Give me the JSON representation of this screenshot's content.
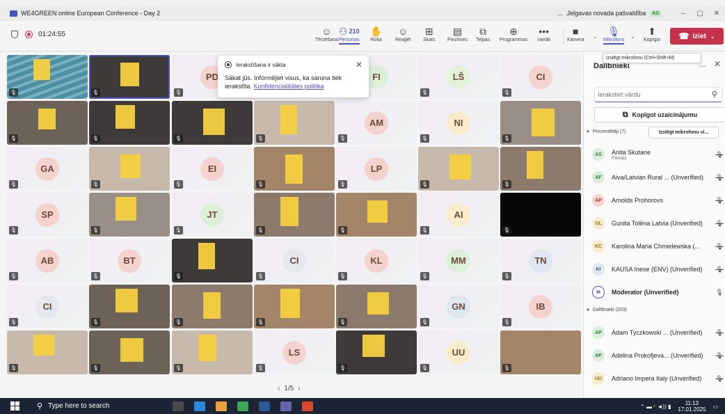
{
  "window": {
    "title": "WE4GREEN online European Conference - Day 2",
    "more": "...",
    "org": "Jelgavas novada pašvaldība",
    "badge": "AS",
    "controls": [
      "–",
      "▢",
      "✕"
    ]
  },
  "toolbar": {
    "timer": "01:24:55",
    "buttons": [
      {
        "label": "Tērzēšana",
        "icon": "chat-icon",
        "glyph": "☺"
      },
      {
        "label": "Personas",
        "icon": "people-icon",
        "glyph": "⚇",
        "count": "210"
      },
      {
        "label": "Roka",
        "icon": "hand-icon",
        "glyph": "✋"
      },
      {
        "label": "Reaģēt",
        "icon": "react-icon",
        "glyph": "☺"
      },
      {
        "label": "Skats",
        "icon": "view-icon",
        "glyph": "⊞"
      },
      {
        "label": "Piezīmes",
        "icon": "notes-icon",
        "glyph": "▤"
      },
      {
        "label": "Telpas",
        "icon": "rooms-icon",
        "glyph": "⧉"
      },
      {
        "label": "Programmas",
        "icon": "apps-icon",
        "glyph": "⊕"
      },
      {
        "label": "Vairāk",
        "icon": "more-icon",
        "glyph": "•••"
      },
      {
        "label": "Kamera",
        "icon": "camera-icon",
        "glyph": "■"
      },
      {
        "label": "Mikrofons",
        "icon": "microphone-icon",
        "glyph": "🎙"
      },
      {
        "label": "Kopīgot",
        "icon": "share-icon",
        "glyph": "⬆"
      }
    ],
    "leave_label": "Iziet",
    "mic_tooltip": "Izslēgt mikrofonu (Ctrl+Shift+M)"
  },
  "toast": {
    "heading": "Ierakstīšana ir sākta",
    "body": "Sākat jūs. Informējiet visus, ka saruna tiek ierakstīta.",
    "link": "Konfidencialitātes politika"
  },
  "grid": {
    "tiles": [
      {
        "kind": "sea",
        "blur": true,
        "selected": false,
        "mic": "muted"
      },
      {
        "kind": "v3",
        "blur": true,
        "selected": true
      },
      {
        "kind": "avatar",
        "initials": "PD",
        "color": "#f4d3cf"
      },
      {
        "kind": "avatar",
        "initials": "",
        "hidden": true
      },
      {
        "kind": "avatar",
        "initials": "FI",
        "color": "#dcefd9"
      },
      {
        "kind": "avatar",
        "initials": "LŠ",
        "color": "#e3f2d9"
      },
      {
        "kind": "avatar",
        "initials": "CI",
        "color": "#f4d3cf"
      },
      {
        "kind": "v1",
        "blur": true
      },
      {
        "kind": "v3",
        "blur": true
      },
      {
        "kind": "v3",
        "blur": true
      },
      {
        "kind": "v5",
        "blur": true
      },
      {
        "kind": "avatar",
        "initials": "AM",
        "color": "#f4d3cf"
      },
      {
        "kind": "avatar",
        "initials": "NI",
        "color": "#f8eccc"
      },
      {
        "kind": "v2",
        "blur": true
      },
      {
        "kind": "avatar",
        "initials": "GA",
        "color": "#f4d3cf"
      },
      {
        "kind": "v5",
        "blur": true
      },
      {
        "kind": "avatar",
        "initials": "EI",
        "color": "#f4d3cf"
      },
      {
        "kind": "v6",
        "blur": true
      },
      {
        "kind": "avatar",
        "initials": "LP",
        "color": "#f4d3cf"
      },
      {
        "kind": "v5",
        "blur": true
      },
      {
        "kind": "v4",
        "blur": true
      },
      {
        "kind": "avatar",
        "initials": "SP",
        "color": "#f4d3cf"
      },
      {
        "kind": "v2",
        "blur": true
      },
      {
        "kind": "avatar",
        "initials": "JT",
        "color": "#dcefd9"
      },
      {
        "kind": "v4",
        "blur": true
      },
      {
        "kind": "v6",
        "blur": true
      },
      {
        "kind": "avatar",
        "initials": "AI",
        "color": "#f8eccc"
      },
      {
        "kind": "black",
        "blur": false
      },
      {
        "kind": "avatar",
        "initials": "AB",
        "color": "#f4d3cf"
      },
      {
        "kind": "avatar",
        "initials": "BT",
        "color": "#f4d3cf"
      },
      {
        "kind": "v3",
        "blur": true
      },
      {
        "kind": "avatar",
        "initials": "CI",
        "color": "#e4e8ee"
      },
      {
        "kind": "avatar",
        "initials": "KL",
        "color": "#f4d3cf"
      },
      {
        "kind": "avatar",
        "initials": "MM",
        "color": "#dcefd9"
      },
      {
        "kind": "avatar",
        "initials": "TN",
        "color": "#dfe7f2"
      },
      {
        "kind": "avatar",
        "initials": "CI",
        "color": "#e4e8ee"
      },
      {
        "kind": "v1",
        "blur": true
      },
      {
        "kind": "v4",
        "blur": true
      },
      {
        "kind": "v6",
        "blur": true
      },
      {
        "kind": "v4",
        "blur": true
      },
      {
        "kind": "avatar",
        "initials": "GN",
        "color": "#dfe7f2"
      },
      {
        "kind": "avatar",
        "initials": "IB",
        "color": "#f4d3cf"
      },
      {
        "kind": "v5",
        "blur": true
      },
      {
        "kind": "v1",
        "blur": true
      },
      {
        "kind": "v5",
        "blur": true
      },
      {
        "kind": "avatar",
        "initials": "LS",
        "color": "#f4d3cf"
      },
      {
        "kind": "v3",
        "blur": true
      },
      {
        "kind": "avatar",
        "initials": "UU",
        "color": "#f8eccc"
      },
      {
        "kind": "v6",
        "blur": false
      }
    ],
    "pager": {
      "prev": "‹",
      "label": "1/5",
      "next": "›"
    }
  },
  "panel": {
    "title": "Dalībnieki",
    "more": "...",
    "close": "✕",
    "search_placeholder": "Ierakstiet vārdu",
    "copy_label": "Kopīgot uzaicinājumu",
    "presenters_header": "Prezentētāji (7)",
    "mute_all": "Izslēgt mikrofonu vi...",
    "presenters": [
      {
        "initials": "AS",
        "name": "Anita Skutane",
        "sub": "Rīkotājs",
        "color": "#d9ecdd",
        "text": "#2e7d32",
        "muted": true
      },
      {
        "initials": "AF",
        "name": "Aiva/Latvian Rural ... (Unverified)",
        "color": "#d9ecdd",
        "text": "#2e7d32",
        "muted": true
      },
      {
        "initials": "AP",
        "name": "Arnolds Prohorovs",
        "color": "#f6d5d2",
        "text": "#b23a2e",
        "muted": true
      },
      {
        "initials": "GL",
        "name": "Gunita Tolēna Latvia (Unverified)",
        "color": "#f7ebcc",
        "text": "#8a6d1a",
        "muted": true
      },
      {
        "initials": "KC",
        "name": "Karolina Maria Chmielewska (...",
        "color": "#f7ebcc",
        "text": "#8a6d1a",
        "muted": true
      },
      {
        "initials": "KI",
        "name": "KAUSA Inese (ENV) (Unverified)",
        "color": "#e1e8f2",
        "text": "#3b5a80",
        "muted": true
      },
      {
        "initials": "M",
        "name": "Moderator (Unverified)",
        "color": "#ffffff",
        "text": "#4b53bc",
        "muted": false,
        "bold": true
      }
    ],
    "attendees_header": "Dalībnieki (203)",
    "attendees": [
      {
        "initials": "AP",
        "name": "Adam Tyczkowski ... (Unverified)",
        "color": "#d9ecdd",
        "text": "#2e7d32",
        "muted": true
      },
      {
        "initials": "AP",
        "name": "Adelina Prokofjeva... (Unverified)",
        "color": "#d9ecdd",
        "text": "#2e7d32",
        "muted": true
      },
      {
        "initials": "UU",
        "name": "Adriano Impera Italy (Unverified)",
        "color": "#f7ebcc",
        "text": "#8a6d1a",
        "muted": true
      }
    ]
  },
  "taskbar": {
    "search_placeholder": "Type here to search",
    "apps": [
      "#4a4a4a",
      "#2b88d8",
      "#e8a33d",
      "#3aa757",
      "#2b5797",
      "#6264a7",
      "#d9462b"
    ],
    "time": "11:13",
    "date": "17.01.2025"
  }
}
